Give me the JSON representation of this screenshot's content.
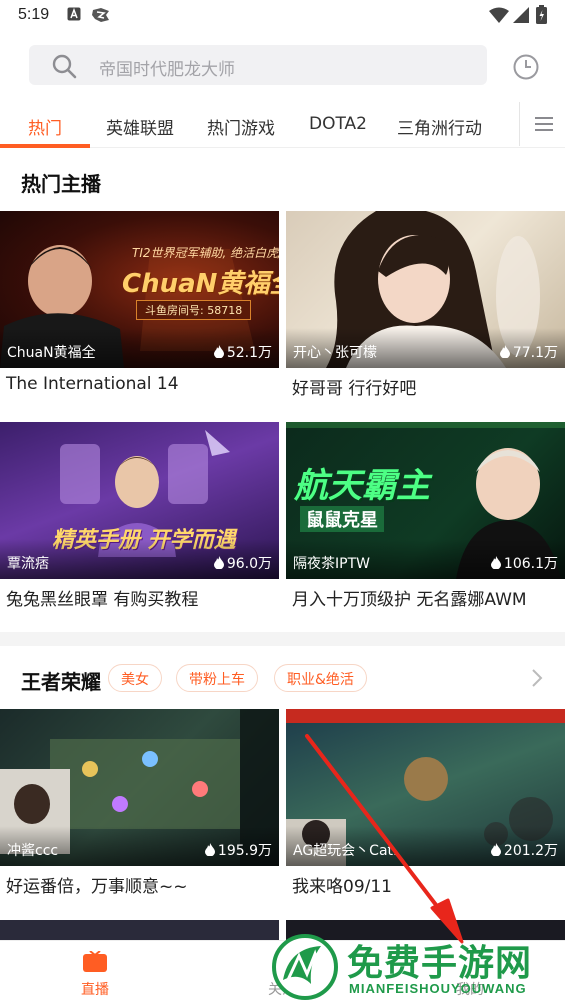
{
  "status_bar": {
    "time": "5:19"
  },
  "search": {
    "placeholder": "帝国时代肥龙大师"
  },
  "tabs": [
    {
      "label": "热门",
      "active": true
    },
    {
      "label": "英雄联盟"
    },
    {
      "label": "热门游戏"
    },
    {
      "label": "DOTA2"
    },
    {
      "label": "三角洲行动"
    }
  ],
  "hot_anchors": {
    "title": "热门主播",
    "cards": [
      {
        "anchor": "ChuaN黄福全",
        "views": "52.1万",
        "title": "The International 14",
        "banner_line1": "TI2世界冠军辅助, 绝活白虎/莱恩",
        "banner_line2": "ChuaN黄福全",
        "banner_line3": "斗鱼房间号: 58718"
      },
      {
        "anchor": "开心丶张可檬",
        "views": "77.1万",
        "title": "好哥哥 行行好吧"
      },
      {
        "anchor": "覃流痞",
        "views": "96.0万",
        "title": "兔兔黑丝眼罩 有购买教程",
        "banner_line1": "精英手册 开学而遇"
      },
      {
        "anchor": "隔夜茶IPTW",
        "views": "106.1万",
        "title": "月入十万顶级护 无名露娜AWM",
        "banner_line1": "航天霸主",
        "banner_line2": "鼠鼠克星"
      }
    ]
  },
  "honor_of_kings": {
    "title": "王者荣耀",
    "chips": [
      "美女",
      "带粉上车",
      "职业&绝活"
    ],
    "cards": [
      {
        "anchor": "冲酱ccc",
        "views": "195.9万",
        "title": "好运番倍，万事顺意~~"
      },
      {
        "anchor": "AG超玩会丶Cat.",
        "views": "201.2万",
        "title": "我来咯09/11"
      }
    ]
  },
  "bottom_nav": [
    {
      "label": "直播",
      "active": true
    },
    {
      "label": "关注"
    },
    {
      "label": "我的"
    }
  ],
  "watermark": {
    "main": "免费手游网",
    "sub": "MIANFEISHOUYOUWANG"
  },
  "colors": {
    "accent": "#ff5d23",
    "watermark": "#1f9a4a",
    "arrow": "#e8261b"
  }
}
